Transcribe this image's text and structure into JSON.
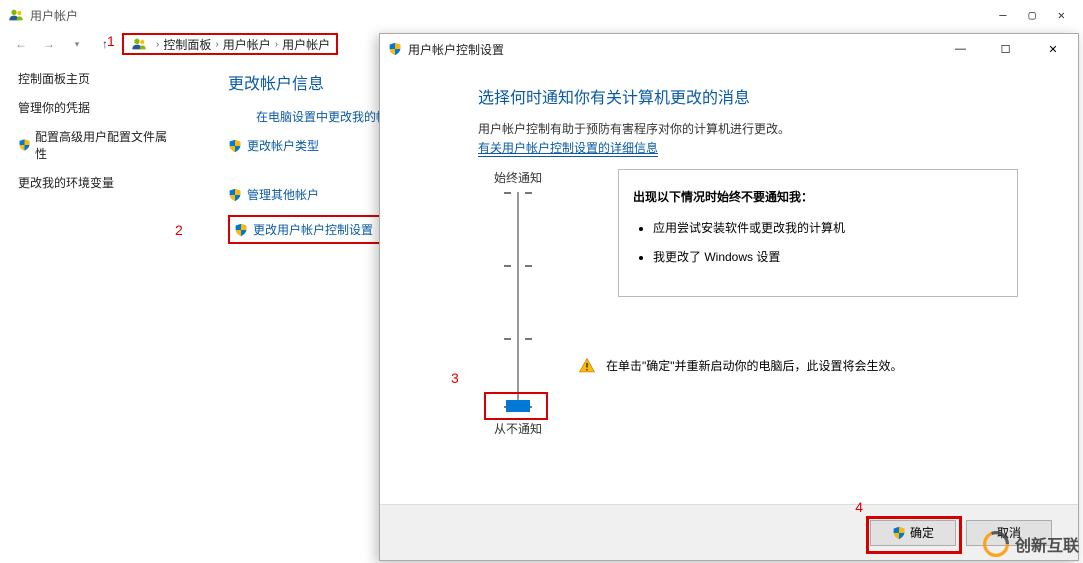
{
  "cp": {
    "window_title": "用户帐户",
    "breadcrumbs": [
      "控制面板",
      "用户帐户",
      "用户帐户"
    ],
    "sidebar": {
      "home": "控制面板主页",
      "links": [
        {
          "label": "管理你的凭据",
          "shield": false
        },
        {
          "label": "配置高级用户配置文件属性",
          "shield": true
        },
        {
          "label": "更改我的环境变量",
          "shield": false
        }
      ]
    },
    "main": {
      "title": "更改帐户信息",
      "links": [
        {
          "label": "在电脑设置中更改我的帐户信息",
          "shield": false,
          "indent": true
        },
        {
          "label": "更改帐户类型",
          "shield": true,
          "indent": false
        },
        {
          "label": "管理其他帐户",
          "shield": true,
          "indent": false,
          "group2": true
        },
        {
          "label": "更改用户帐户控制设置",
          "shield": true,
          "uac": true,
          "group2": true
        }
      ]
    }
  },
  "uac": {
    "title": "用户帐户控制设置",
    "headline": "选择何时通知你有关计算机更改的消息",
    "description": "用户帐户控制有助于预防有害程序对你的计算机进行更改。",
    "info_link": "有关用户帐户控制设置的详细信息",
    "slider": {
      "top_label": "始终通知",
      "bottom_label": "从不通知"
    },
    "never_box": {
      "title": "出现以下情况时始终不要通知我：",
      "items": [
        "应用尝试安装软件或更改我的计算机",
        "我更改了 Windows 设置"
      ]
    },
    "warning": "在单击\"确定\"并重新启动你的电脑后，此设置将会生效。",
    "buttons": {
      "ok": "确定",
      "cancel": "取消"
    }
  },
  "annotations": {
    "a1": "1",
    "a2": "2",
    "a3": "3",
    "a4": "4"
  },
  "watermark": "创新互联"
}
